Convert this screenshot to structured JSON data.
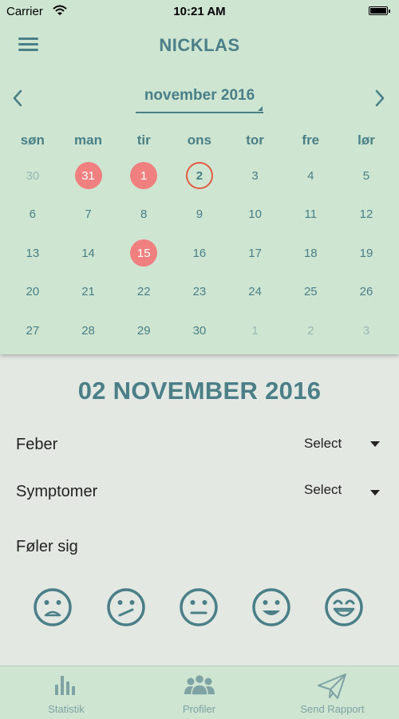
{
  "status_bar": {
    "carrier": "Carrier",
    "time": "10:21 AM"
  },
  "header": {
    "title": "NICKLAS"
  },
  "calendar": {
    "month_label": "november 2016",
    "weekdays": [
      "søn",
      "man",
      "tir",
      "ons",
      "tor",
      "fre",
      "lør"
    ],
    "days": [
      {
        "label": "30",
        "state": "muted"
      },
      {
        "label": "31",
        "state": "marked"
      },
      {
        "label": "1",
        "state": "marked"
      },
      {
        "label": "2",
        "state": "today"
      },
      {
        "label": "3",
        "state": "normal"
      },
      {
        "label": "4",
        "state": "normal"
      },
      {
        "label": "5",
        "state": "normal"
      },
      {
        "label": "6",
        "state": "normal"
      },
      {
        "label": "7",
        "state": "normal"
      },
      {
        "label": "8",
        "state": "normal"
      },
      {
        "label": "9",
        "state": "normal"
      },
      {
        "label": "10",
        "state": "normal"
      },
      {
        "label": "11",
        "state": "normal"
      },
      {
        "label": "12",
        "state": "normal"
      },
      {
        "label": "13",
        "state": "normal"
      },
      {
        "label": "14",
        "state": "normal"
      },
      {
        "label": "15",
        "state": "marked"
      },
      {
        "label": "16",
        "state": "normal"
      },
      {
        "label": "17",
        "state": "normal"
      },
      {
        "label": "18",
        "state": "normal"
      },
      {
        "label": "19",
        "state": "normal"
      },
      {
        "label": "20",
        "state": "normal"
      },
      {
        "label": "21",
        "state": "normal"
      },
      {
        "label": "22",
        "state": "normal"
      },
      {
        "label": "23",
        "state": "normal"
      },
      {
        "label": "24",
        "state": "normal"
      },
      {
        "label": "25",
        "state": "normal"
      },
      {
        "label": "26",
        "state": "normal"
      },
      {
        "label": "27",
        "state": "normal"
      },
      {
        "label": "28",
        "state": "normal"
      },
      {
        "label": "29",
        "state": "normal"
      },
      {
        "label": "30",
        "state": "normal"
      },
      {
        "label": "1",
        "state": "muted"
      },
      {
        "label": "2",
        "state": "muted"
      },
      {
        "label": "3",
        "state": "muted"
      }
    ]
  },
  "selected_date": "02 NOVEMBER 2016",
  "form": {
    "fever": {
      "label": "Feber",
      "value": "Select"
    },
    "symptoms": {
      "label": "Symptomer",
      "value": "Select"
    },
    "feeling": {
      "label": "Føler sig"
    },
    "moods": [
      "sad-face-icon",
      "confused-face-icon",
      "neutral-face-icon",
      "smile-face-icon",
      "laughing-face-icon"
    ]
  },
  "tabs": [
    {
      "label": "Statistik",
      "icon": "bar-chart-icon"
    },
    {
      "label": "Profiler",
      "icon": "people-icon"
    },
    {
      "label": "Send Rapport",
      "icon": "paper-plane-icon"
    }
  ],
  "colors": {
    "panel_bg": "#cde5d1",
    "page_bg": "#e4e8e3",
    "accent": "#4a7f87",
    "marked_day": "#f08080",
    "today_ring": "#e35a45"
  }
}
